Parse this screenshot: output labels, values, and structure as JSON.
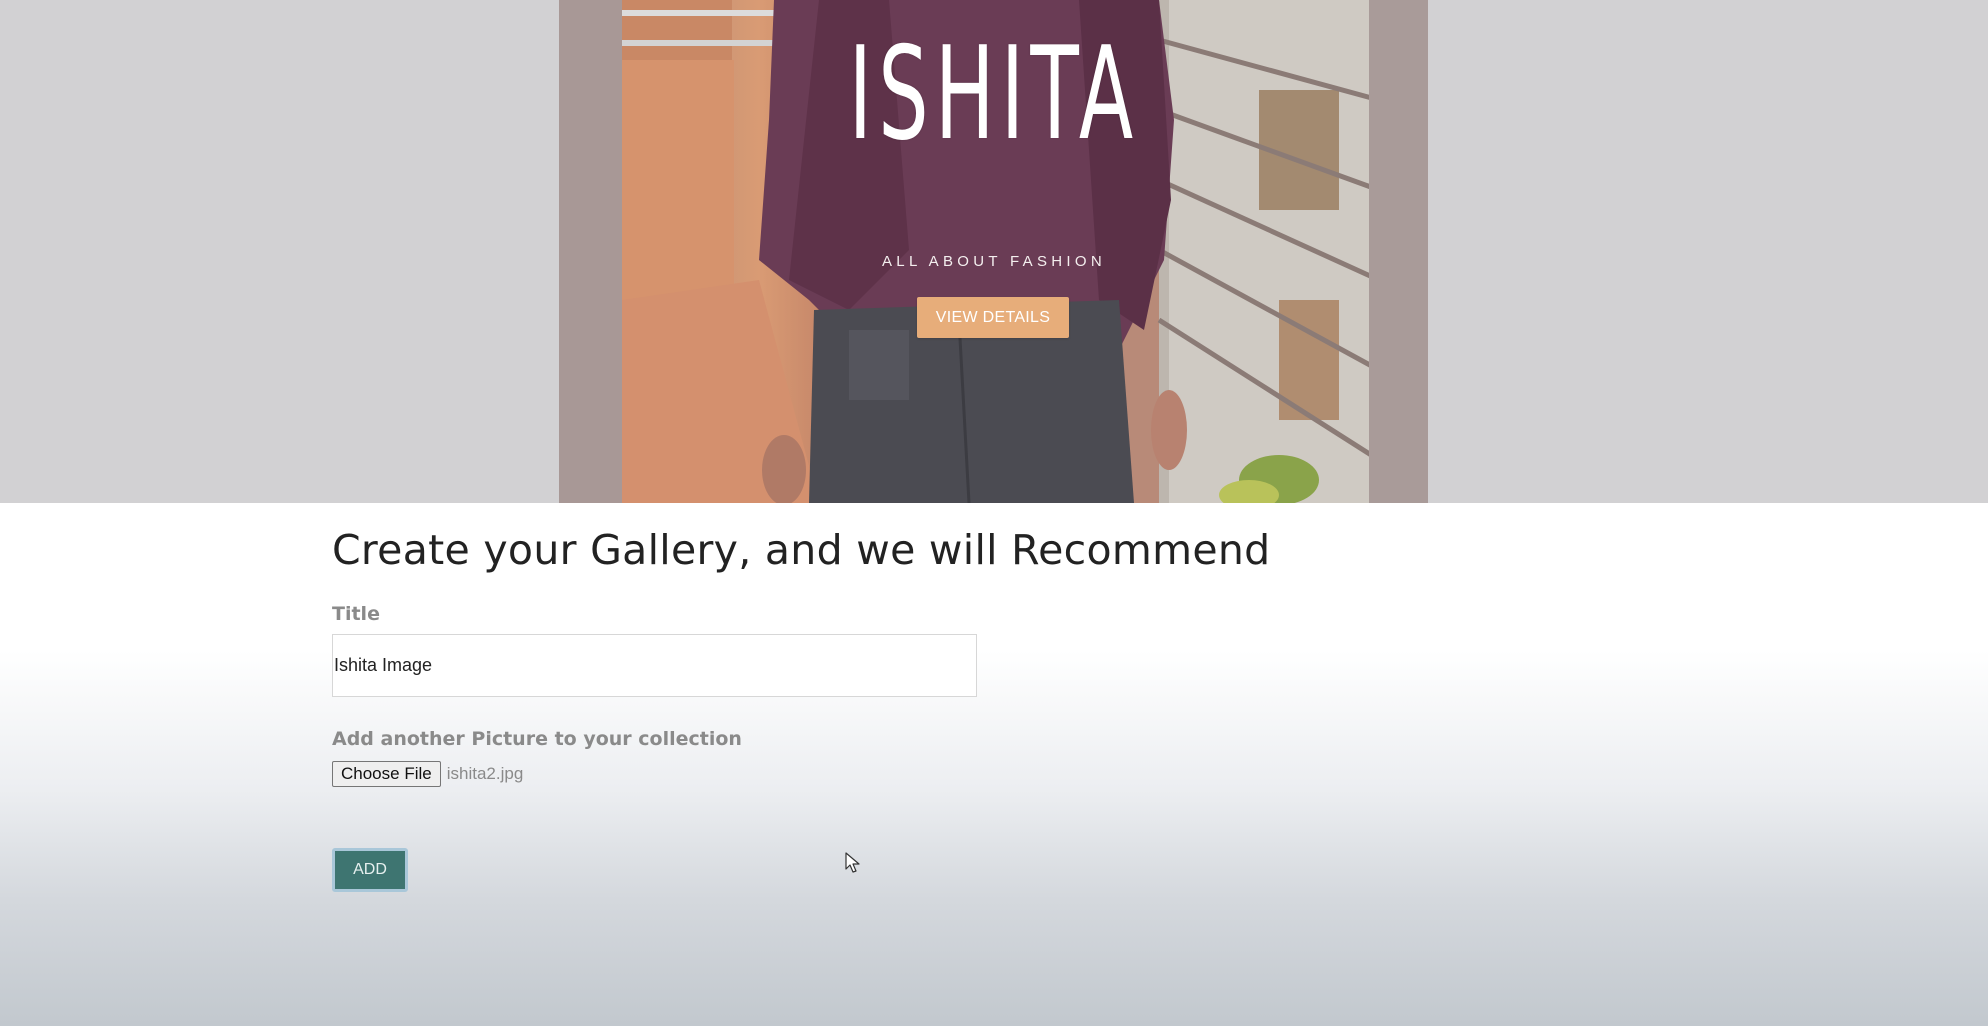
{
  "hero": {
    "title": "ISHITA",
    "subtitle": "ALL ABOUT FASHION",
    "button_label": "VIEW DETAILS"
  },
  "form": {
    "heading": "Create your Gallery, and we will Recommend",
    "title_label": "Title",
    "title_value": "Ishita Image",
    "picture_label": "Add another Picture to your collection",
    "choose_file_label": "Choose File",
    "file_name": "ishita2.jpg",
    "add_label": "ADD"
  },
  "colors": {
    "hero_button": "#e7ad7a",
    "add_button": "#3e7571",
    "heading_text": "#222222",
    "label_text": "#8a8a8a"
  },
  "icons": {
    "cursor": "mouse-pointer-icon"
  }
}
